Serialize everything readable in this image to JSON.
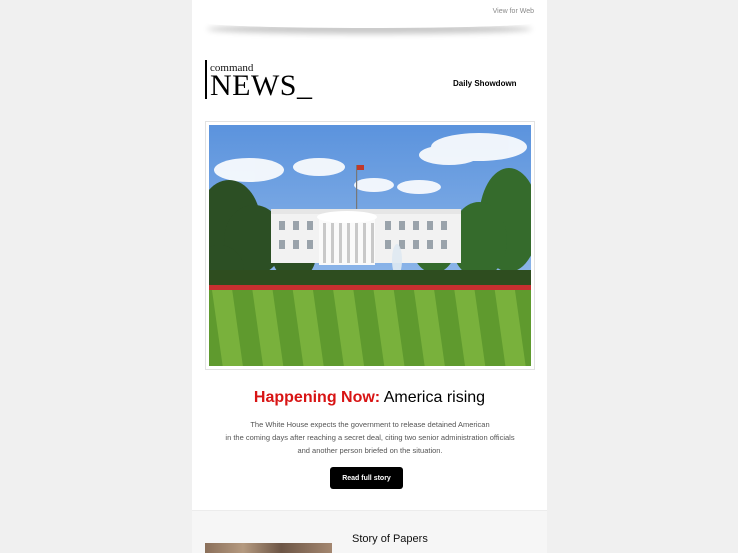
{
  "header": {
    "view_web_label": "View for Web"
  },
  "brand": {
    "logo_small": "command",
    "logo_big": "NEWS_",
    "tagline": "Daily Showdown"
  },
  "feature": {
    "headline_highlight": "Happening Now:",
    "headline_rest": " America rising",
    "summary_lines": [
      "The White House expects the government to release detained American",
      "in the coming days after reaching a secret deal, citing two senior administration officials",
      "and another person briefed on the situation."
    ],
    "button_label": "Read full story"
  },
  "story2": {
    "title": "Story of Papers"
  },
  "colors": {
    "accent_red": "#d81414",
    "button_bg": "#000000"
  }
}
